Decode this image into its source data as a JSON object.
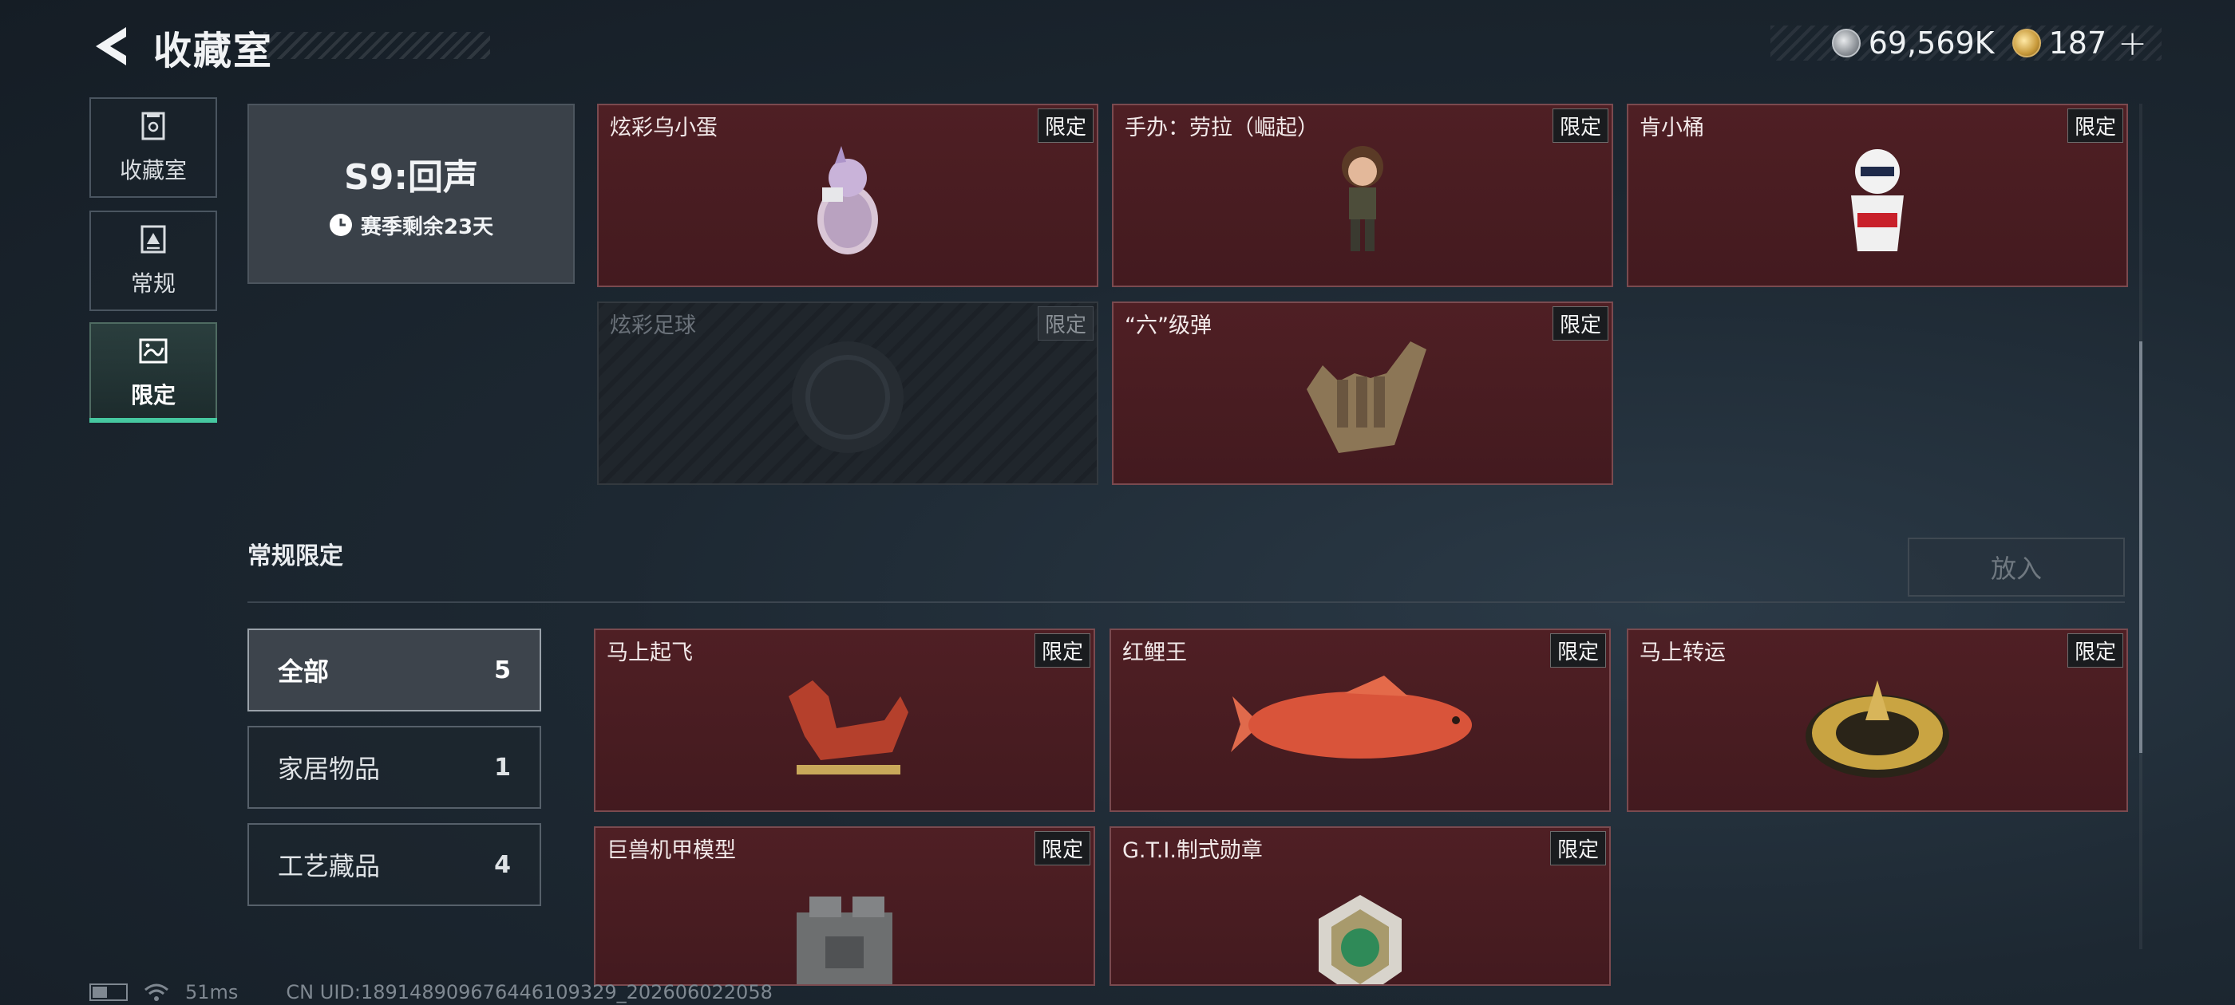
{
  "header": {
    "title": "收藏室",
    "currency": [
      {
        "icon": "silver-coin-icon",
        "value": "69,569K"
      },
      {
        "icon": "gold-coin-icon",
        "value": "187"
      }
    ],
    "plus": "+"
  },
  "sidebar": {
    "items": [
      {
        "label": "收藏室",
        "icon": "collection-box-icon",
        "active": false
      },
      {
        "label": "常规",
        "icon": "document-icon",
        "active": false
      },
      {
        "label": "限定",
        "icon": "limited-image-icon",
        "active": true
      }
    ]
  },
  "season": {
    "title": "S9:回声",
    "remaining": "赛季剩余23天"
  },
  "season_items": [
    {
      "name": "炫彩乌小蛋",
      "tag": "限定",
      "locked": false
    },
    {
      "name": "手办：劳拉（崛起）",
      "tag": "限定",
      "locked": false
    },
    {
      "name": "肯小桶",
      "tag": "限定",
      "locked": false
    },
    {
      "name": "炫彩足球",
      "tag": "限定",
      "locked": true
    },
    {
      "name": "“六”级弹",
      "tag": "限定",
      "locked": false
    }
  ],
  "section": {
    "title": "常规限定",
    "put_button": "放入"
  },
  "filters": [
    {
      "label": "全部",
      "count": "5",
      "active": true
    },
    {
      "label": "家居物品",
      "count": "1",
      "active": false
    },
    {
      "label": "工艺藏品",
      "count": "4",
      "active": false
    }
  ],
  "regular_items": [
    {
      "name": "马上起飞",
      "tag": "限定"
    },
    {
      "name": "红鲤王",
      "tag": "限定"
    },
    {
      "name": "马上转运",
      "tag": "限定"
    },
    {
      "name": "巨兽机甲模型",
      "tag": "限定"
    },
    {
      "name": "G.T.I.制式勋章",
      "tag": "限定"
    }
  ],
  "status_bar": {
    "latency": "51ms",
    "uid": "CN UID:189148909676446109329_202606022058"
  },
  "colors": {
    "card_bg": "#4a1d22",
    "accent": "#46c8a0"
  }
}
